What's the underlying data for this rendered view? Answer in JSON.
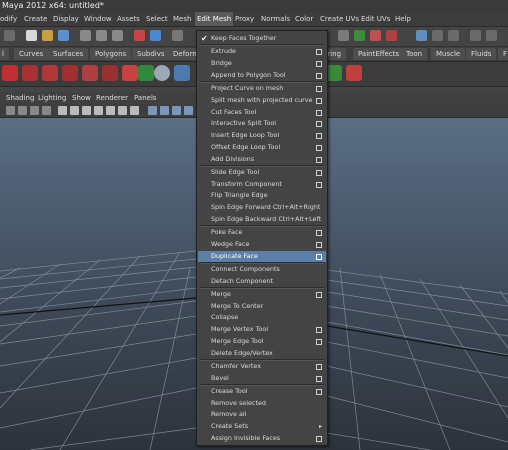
{
  "window": {
    "title": "Maya 2012 x64: untitled*"
  },
  "menubar": [
    "odify",
    "Create",
    "Display",
    "Window",
    "Assets",
    "Select",
    "Mesh",
    "Edit Mesh",
    "Proxy",
    "Normals",
    "Color",
    "Create UVs",
    "Edit UVs",
    "Help"
  ],
  "shelf_tabs": [
    "l",
    "Curves",
    "Surfaces",
    "Polygons",
    "Subdivs",
    "Deform",
    "ering",
    "PaintEffects",
    "Toon",
    "Muscle",
    "Fluids",
    "F"
  ],
  "panel_menu": [
    "Shading",
    "Lighting",
    "Show",
    "Renderer",
    "Panels"
  ],
  "edit_mesh_menu": {
    "items": [
      {
        "label": "Keep Faces Together",
        "checked": true
      },
      {
        "label": "Extrude",
        "option": true
      },
      {
        "label": "Bridge",
        "option": true
      },
      {
        "label": "Append to Polygon Tool",
        "option": true
      },
      {
        "label": "Project Curve on mesh",
        "option": true
      },
      {
        "label": "Split mesh with projected curve",
        "option": true
      },
      {
        "label": "Cut Faces Tool",
        "option": true
      },
      {
        "label": "Interactive Split Tool",
        "option": true
      },
      {
        "label": "Insert Edge Loop Tool",
        "option": true
      },
      {
        "label": "Offset Edge Loop Tool",
        "option": true
      },
      {
        "label": "Add Divisions",
        "option": true
      },
      {
        "label": "Slide Edge Tool",
        "option": true
      },
      {
        "label": "Transform Component",
        "option": true
      },
      {
        "label": "Flip Triangle Edge"
      },
      {
        "label": "Spin Edge Forward  Ctrl+Alt+Right"
      },
      {
        "label": "Spin Edge Backward  Ctrl+Alt+Left"
      },
      {
        "label": "Poke Face",
        "option": true
      },
      {
        "label": "Wedge Face",
        "option": true
      },
      {
        "label": "Duplicate Face",
        "option": true,
        "highlighted": true
      },
      {
        "label": "Connect Components"
      },
      {
        "label": "Detach Component"
      },
      {
        "label": "Merge",
        "option": true
      },
      {
        "label": "Merge To Center"
      },
      {
        "label": "Collapse"
      },
      {
        "label": "Merge Vertex Tool",
        "option": true
      },
      {
        "label": "Merge Edge Tool",
        "option": true
      },
      {
        "label": "Delete Edge/Vertex"
      },
      {
        "label": "Chamfer Vertex",
        "option": true
      },
      {
        "label": "Bevel",
        "option": true
      },
      {
        "label": "Crease Tool",
        "option": true
      },
      {
        "label": "Remove selected"
      },
      {
        "label": "Remove all"
      },
      {
        "label": "Create Sets",
        "submenu": true
      },
      {
        "label": "Assign Invisible Faces",
        "option": true
      }
    ]
  },
  "colors": {
    "highlight": "#5c7fa8",
    "viewport_top": "#5a6e85",
    "viewport_bottom": "#2d333b"
  }
}
